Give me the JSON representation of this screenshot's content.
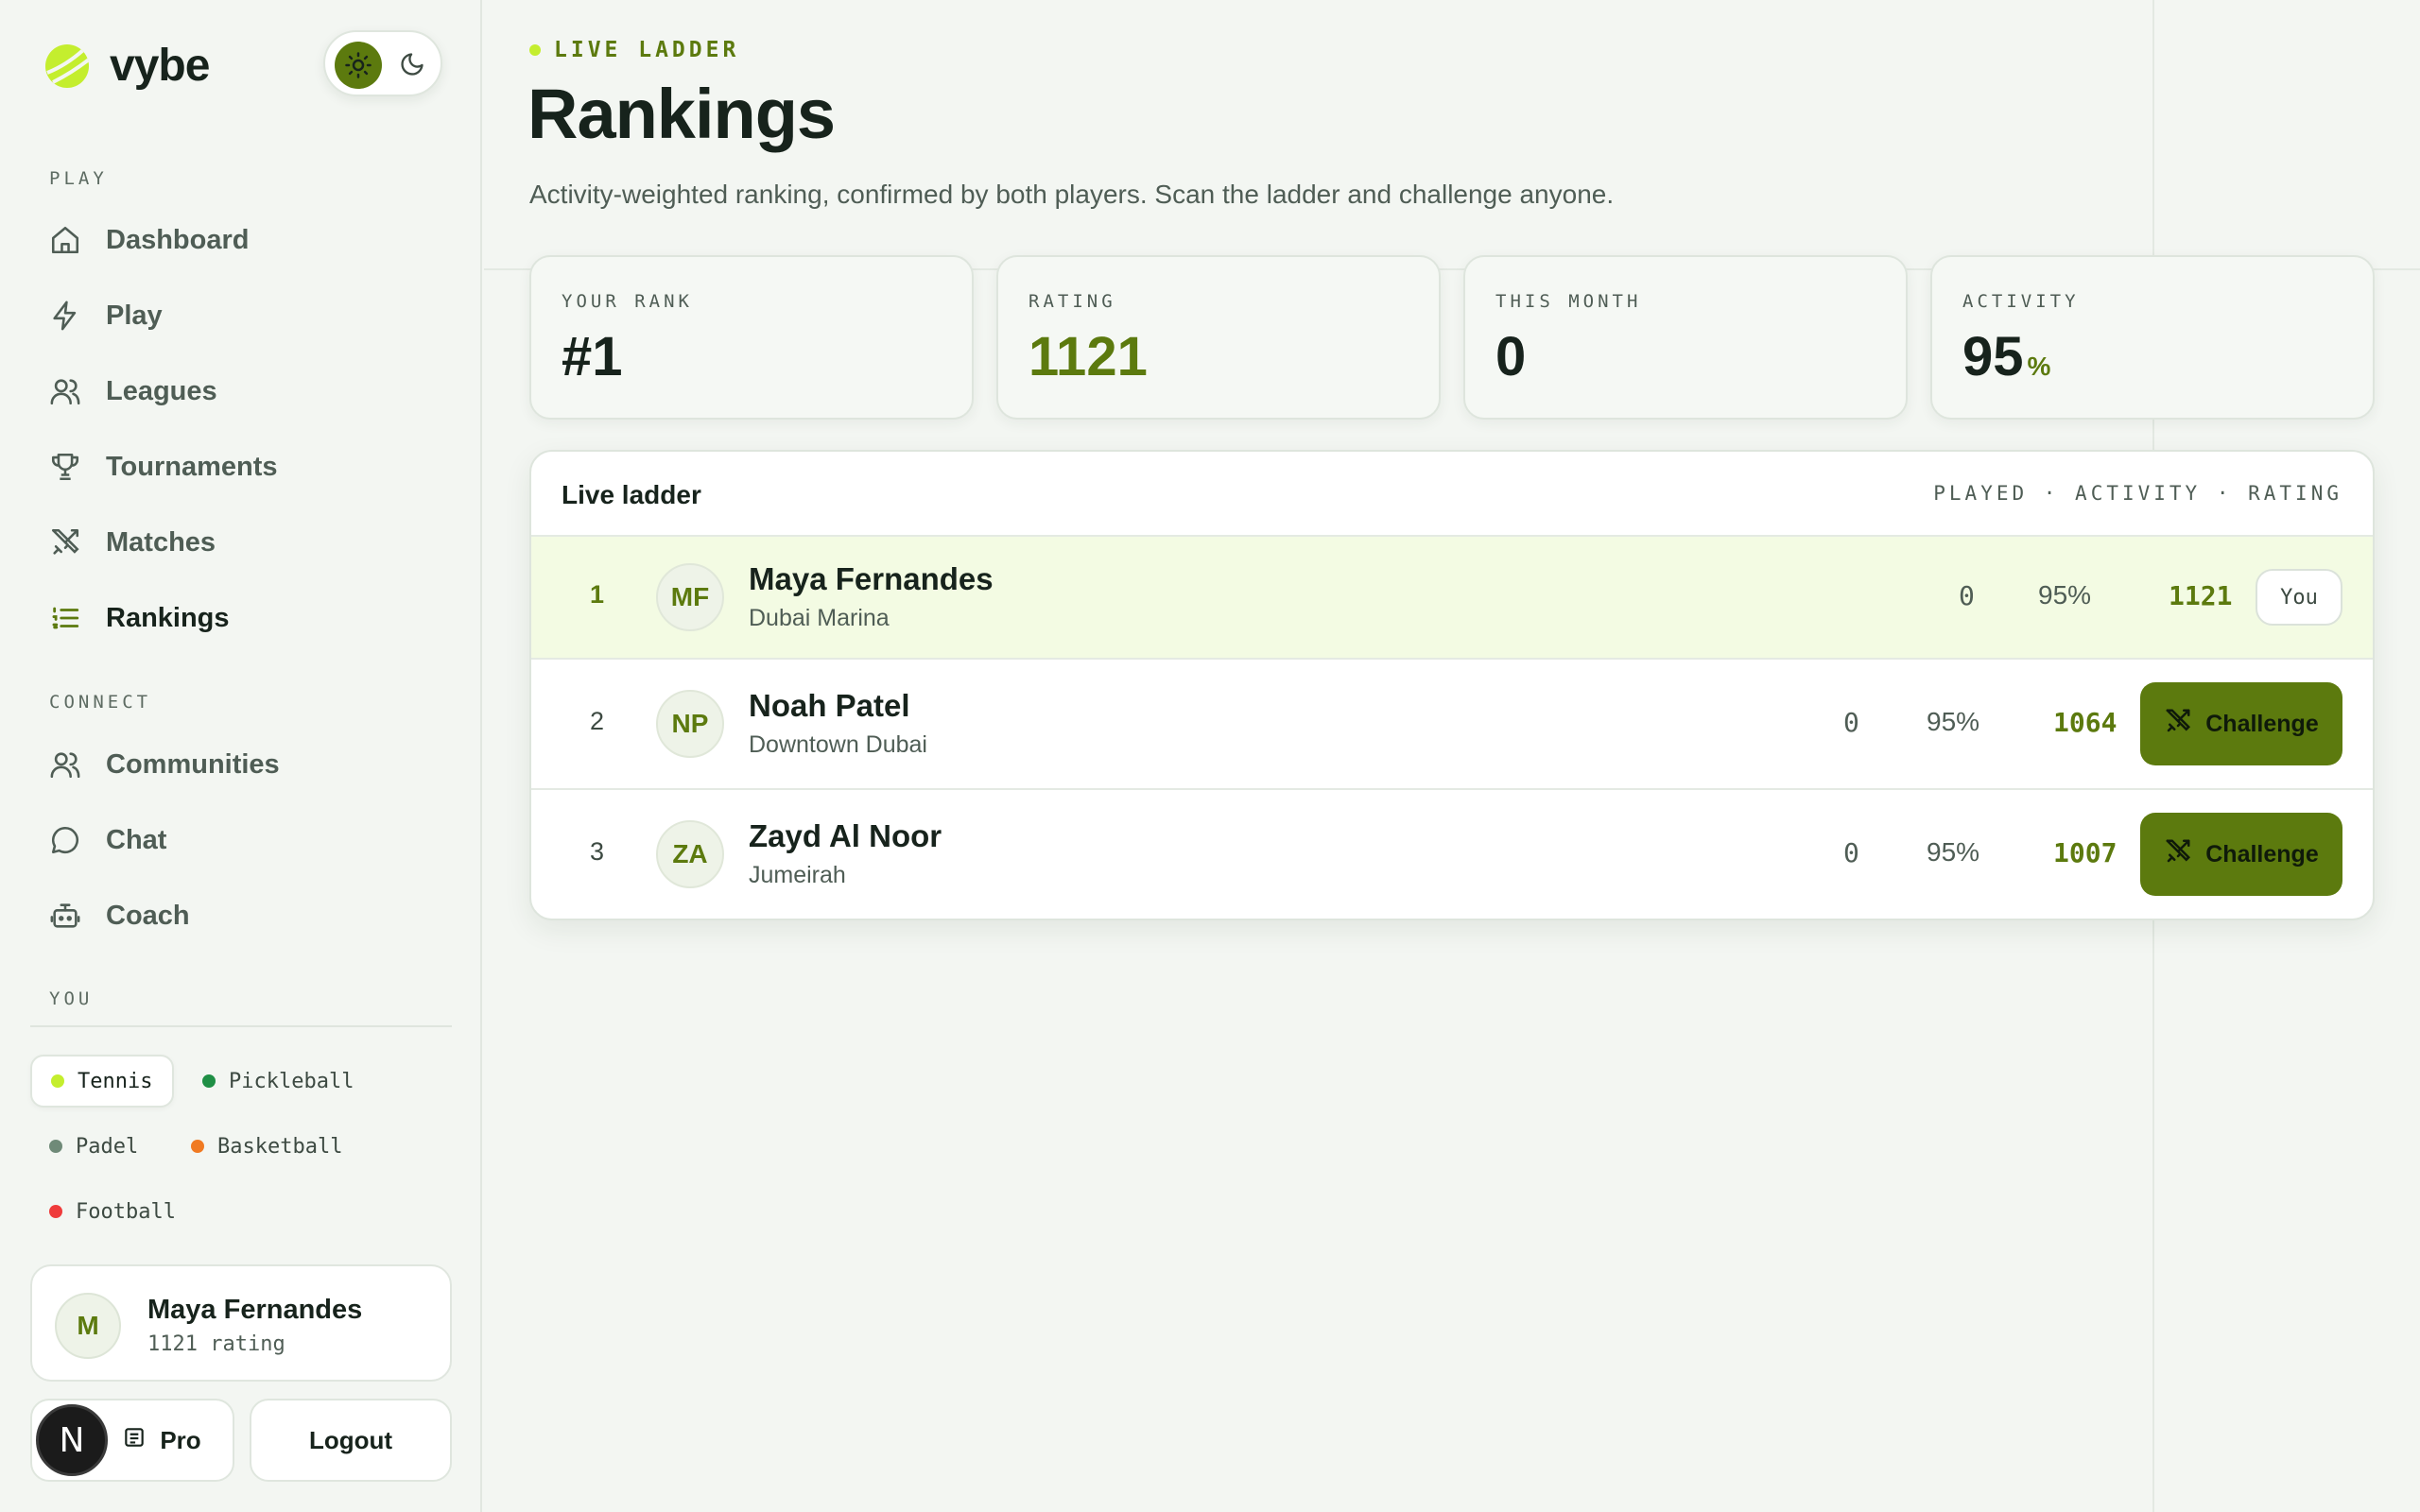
{
  "brand": {
    "name": "vybe"
  },
  "sidebar": {
    "sections": {
      "play": "PLAY",
      "connect": "CONNECT",
      "you": "YOU"
    },
    "play_items": [
      {
        "label": "Dashboard",
        "icon": "home-icon"
      },
      {
        "label": "Play",
        "icon": "bolt-icon"
      },
      {
        "label": "Leagues",
        "icon": "users-icon"
      },
      {
        "label": "Tournaments",
        "icon": "trophy-icon"
      },
      {
        "label": "Matches",
        "icon": "crossed-swords-icon"
      },
      {
        "label": "Rankings",
        "icon": "list-icon",
        "active": true
      }
    ],
    "connect_items": [
      {
        "label": "Communities",
        "icon": "users-icon"
      },
      {
        "label": "Chat",
        "icon": "chat-bubble-icon"
      },
      {
        "label": "Coach",
        "icon": "robot-icon"
      }
    ],
    "sports": [
      {
        "label": "Tennis",
        "color": "#c4ee2e",
        "active": true
      },
      {
        "label": "Pickleball",
        "color": "#1f8f45"
      },
      {
        "label": "Padel",
        "color": "#6f8a78"
      },
      {
        "label": "Basketball",
        "color": "#f07a22"
      },
      {
        "label": "Football",
        "color": "#ef3b3b"
      }
    ],
    "user": {
      "initial": "M",
      "name": "Maya Fernandes",
      "rating": "1121 rating"
    },
    "pro_label": "Pro",
    "logout_label": "Logout",
    "badge_letter": "N"
  },
  "header": {
    "eyebrow": "LIVE LADDER",
    "title": "Rankings",
    "subtitle": "Activity-weighted ranking, confirmed by both players. Scan the ladder and challenge anyone."
  },
  "stats": [
    {
      "label": "YOUR RANK",
      "value": "#1",
      "suffix": ""
    },
    {
      "label": "RATING",
      "value": "1121",
      "suffix": ""
    },
    {
      "label": "THIS MONTH",
      "value": "0",
      "suffix": ""
    },
    {
      "label": "ACTIVITY",
      "value": "95",
      "suffix": "%"
    }
  ],
  "ladder": {
    "title": "Live ladder",
    "columns": "PLAYED · ACTIVITY · RATING",
    "you_label": "You",
    "challenge_label": "Challenge",
    "rows": [
      {
        "rank": "1",
        "initials": "MF",
        "name": "Maya Fernandes",
        "location": "Dubai Marina",
        "played": "0",
        "activity": "95%",
        "rating": "1121",
        "is_you": true
      },
      {
        "rank": "2",
        "initials": "NP",
        "name": "Noah Patel",
        "location": "Downtown Dubai",
        "played": "0",
        "activity": "95%",
        "rating": "1064",
        "is_you": false
      },
      {
        "rank": "3",
        "initials": "ZA",
        "name": "Zayd Al Noor",
        "location": "Jumeirah",
        "played": "0",
        "activity": "95%",
        "rating": "1007",
        "is_you": false
      }
    ]
  },
  "colors": {
    "accent": "#5c7a0e",
    "lime": "#c4ee2e",
    "highlight_row": "#f3fbe3"
  }
}
